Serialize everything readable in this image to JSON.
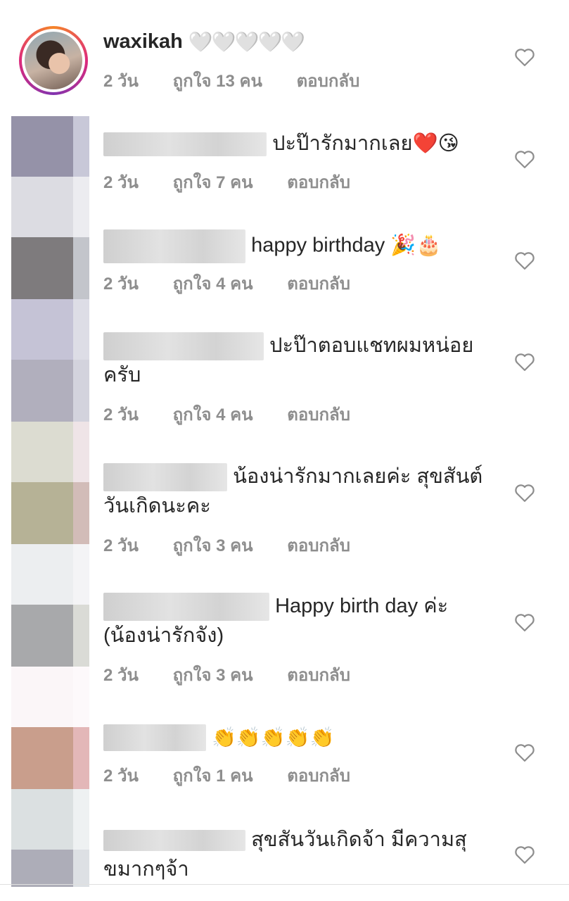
{
  "comments": [
    {
      "username": "waxikah",
      "text": "🤍🤍🤍🤍🤍",
      "time": "2 วัน",
      "likes": "ถูกใจ 13 คน",
      "reply": "ตอบกลับ"
    },
    {
      "text": "ปะป๊ารักมากเลย❤️😘",
      "time": "2 วัน",
      "likes": "ถูกใจ 7 คน",
      "reply": "ตอบกลับ"
    },
    {
      "text": "happy birthday 🎉🎂",
      "time": "2 วัน",
      "likes": "ถูกใจ 4 คน",
      "reply": "ตอบกลับ"
    },
    {
      "text": "ปะป๊าตอบแชทผมหน่อยครับ",
      "time": "2 วัน",
      "likes": "ถูกใจ 4 คน",
      "reply": "ตอบกลับ"
    },
    {
      "text": "น้องน่ารักมากเลยค่ะ สุขสันต์วันเกิดนะคะ",
      "time": "2 วัน",
      "likes": "ถูกใจ 3 คน",
      "reply": "ตอบกลับ"
    },
    {
      "text": "Happy birth day ค่ะ (น้องน่ารักจัง)",
      "time": "2 วัน",
      "likes": "ถูกใจ 3 คน",
      "reply": "ตอบกลับ"
    },
    {
      "text": "👏👏👏👏👏",
      "time": "2 วัน",
      "likes": "ถูกใจ 1 คน",
      "reply": "ตอบกลับ"
    },
    {
      "text": "สุขสันวันเกิดจ้า มีความสุขมากๆจ้า"
    }
  ]
}
